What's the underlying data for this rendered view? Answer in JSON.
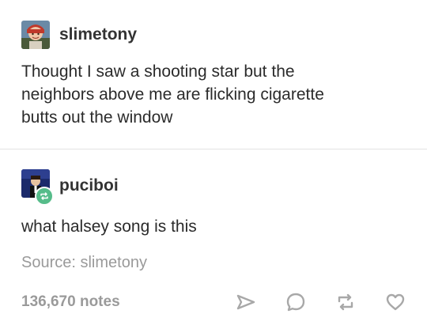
{
  "post": {
    "author": "slimetony",
    "text_line1": "Thought I saw a shooting star but the",
    "text_line2": "neighbors above me are flicking cigarette",
    "text_line3": "butts out the window"
  },
  "reply": {
    "author": "puciboi",
    "text": "what halsey song is this"
  },
  "source": {
    "label": "Source: slimetony"
  },
  "footer": {
    "notes": "136,670 notes",
    "actions": [
      "share-icon",
      "comment-icon",
      "reblog-icon",
      "like-icon"
    ]
  },
  "colors": {
    "reblog_badge": "#56bc8a",
    "muted_text": "#9a9a9a",
    "divider": "#e2e2e2"
  }
}
